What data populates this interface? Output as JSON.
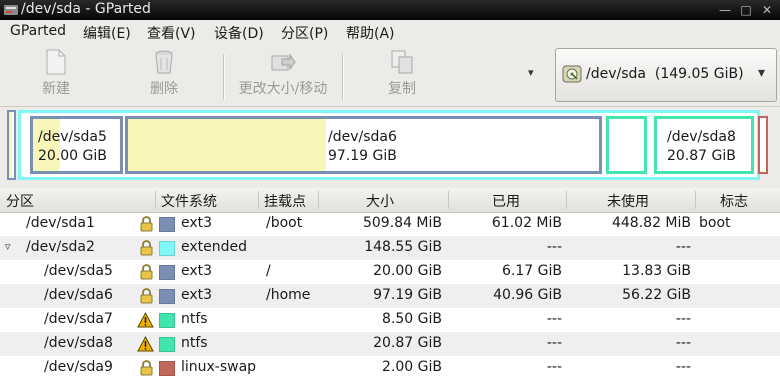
{
  "window": {
    "title": "/dev/sda - GParted",
    "controls": [
      "minimize-icon",
      "maximize-icon",
      "close-icon"
    ],
    "control_glyphs": [
      "—",
      "□",
      "✕"
    ]
  },
  "menu": [
    {
      "label": "GParted",
      "key": "menu-gparted"
    },
    {
      "label": "编辑(E)",
      "key": "menu-edit"
    },
    {
      "label": "查看(V)",
      "key": "menu-view"
    },
    {
      "label": "设备(D)",
      "key": "menu-device"
    },
    {
      "label": "分区(P)",
      "key": "menu-partition"
    },
    {
      "label": "帮助(A)",
      "key": "menu-help"
    }
  ],
  "toolbar": {
    "new_label": "新建",
    "delete_label": "删除",
    "resize_label": "更改大小/移动",
    "copy_label": "复制",
    "more_arrow": "▾",
    "device_selector": "/dev/sda  (149.05 GiB)",
    "device_selector_arrow": "▾"
  },
  "diskmap": {
    "sda5": {
      "name": "/dev/sda5",
      "size": "20.00 GiB",
      "used_fraction": 0.31
    },
    "sda6": {
      "name": "/dev/sda6",
      "size": "97.19 GiB",
      "used_fraction": 0.42
    },
    "sda8": {
      "name": "/dev/sda8",
      "size": "20.87 GiB"
    }
  },
  "table": {
    "headers": {
      "partition": "分区",
      "filesystem": "文件系统",
      "mountpoint": "挂载点",
      "size": "大小",
      "used": "已用",
      "unused": "未使用",
      "flags": "标志"
    },
    "rows": [
      {
        "partition": "/dev/sda1",
        "icon": "lock-icon",
        "fs": "ext3",
        "fs_color": "#7b8fb5",
        "mount": "/boot",
        "size": "509.84 MiB",
        "used": "61.02 MiB",
        "unused": "448.82 MiB",
        "flags": "boot"
      },
      {
        "partition": "/dev/sda2",
        "icon": "lock-icon",
        "fs": "extended",
        "fs_color": "#7ff7f7",
        "mount": "",
        "size": "148.55 GiB",
        "used": "---",
        "unused": "---",
        "flags": ""
      },
      {
        "partition": "/dev/sda5",
        "icon": "lock-icon",
        "fs": "ext3",
        "fs_color": "#7b8fb5",
        "mount": "/",
        "size": "20.00 GiB",
        "used": "6.17 GiB",
        "unused": "13.83 GiB",
        "flags": ""
      },
      {
        "partition": "/dev/sda6",
        "icon": "lock-icon",
        "fs": "ext3",
        "fs_color": "#7b8fb5",
        "mount": "/home",
        "size": "97.19 GiB",
        "used": "40.96 GiB",
        "unused": "56.22 GiB",
        "flags": ""
      },
      {
        "partition": "/dev/sda7",
        "icon": "warning-icon",
        "fs": "ntfs",
        "fs_color": "#42e5ac",
        "mount": "",
        "size": "8.50 GiB",
        "used": "---",
        "unused": "---",
        "flags": ""
      },
      {
        "partition": "/dev/sda8",
        "icon": "warning-icon",
        "fs": "ntfs",
        "fs_color": "#42e5ac",
        "mount": "",
        "size": "20.87 GiB",
        "used": "---",
        "unused": "---",
        "flags": ""
      },
      {
        "partition": "/dev/sda9",
        "icon": "lock-icon",
        "fs": "linux-swap",
        "fs_color": "#c1665a",
        "mount": "",
        "size": "2.00 GiB",
        "used": "---",
        "unused": "---",
        "flags": ""
      }
    ]
  },
  "colors": {
    "ext3": "#7b8fb5",
    "extended": "#7ff7f7",
    "ntfs": "#42e5ac",
    "linux_swap": "#c1665a",
    "used_fill": "#f8f6b8"
  }
}
